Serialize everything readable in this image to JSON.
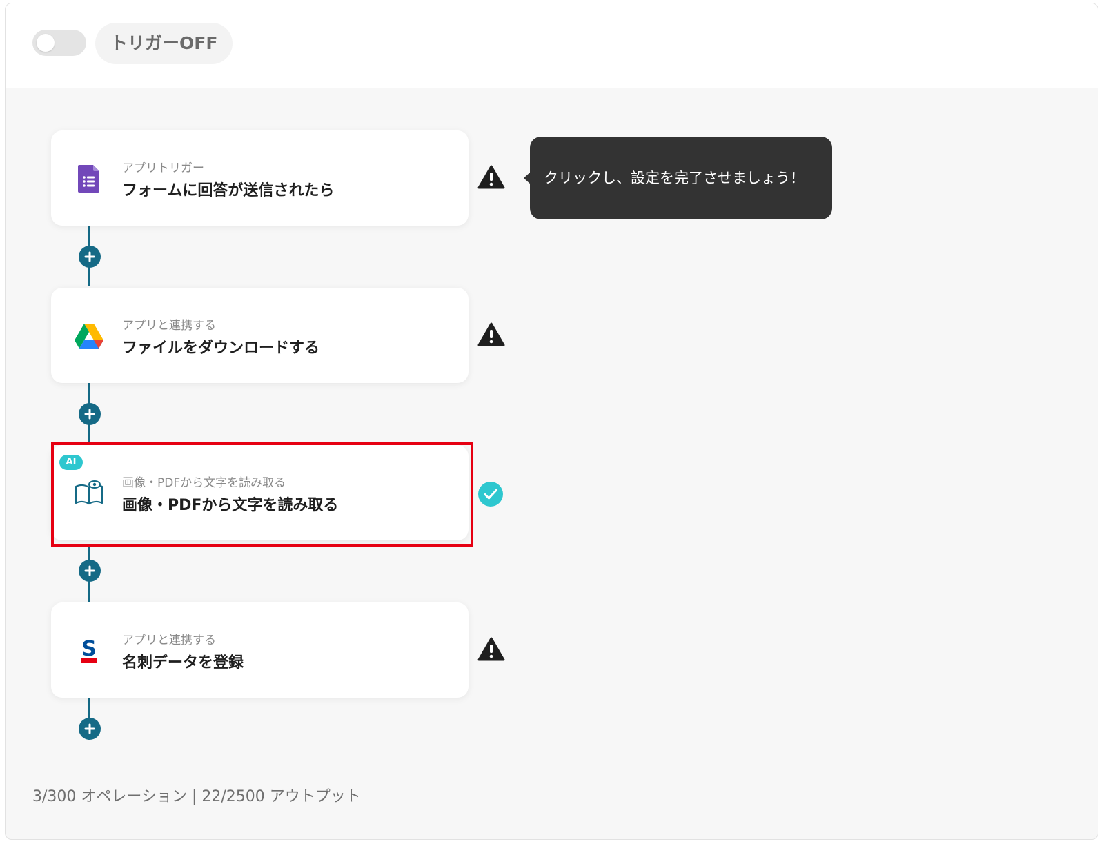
{
  "header": {
    "trigger_toggle_state": "off",
    "trigger_label": "トリガーOFF"
  },
  "tooltip": {
    "text": "クリックし、設定を完了させましょう！"
  },
  "steps": [
    {
      "subtitle": "アプリトリガー",
      "title": "フォームに回答が送信されたら",
      "icon": "google-forms-icon",
      "status": "warning-icon"
    },
    {
      "subtitle": "アプリと連携する",
      "title": "ファイルをダウンロードする",
      "icon": "google-drive-icon",
      "status": "warning-icon"
    },
    {
      "subtitle": "画像・PDFから文字を読み取る",
      "title": "画像・PDFから文字を読み取る",
      "icon": "ocr-book-eye-icon",
      "badge": "AI",
      "status": "check-icon",
      "highlighted": true
    },
    {
      "subtitle": "アプリと連携する",
      "title": "名刺データを登録",
      "icon": "sansan-icon",
      "status": "warning-icon"
    }
  ],
  "footer": {
    "usage": "3/300 オペレーション | 22/2500 アウトプット"
  },
  "colors": {
    "accent": "#156a86",
    "highlight_border": "#e60012",
    "ai_badge": "#2ec7cf",
    "check": "#2ec7cf",
    "tooltip_bg": "#333333"
  }
}
